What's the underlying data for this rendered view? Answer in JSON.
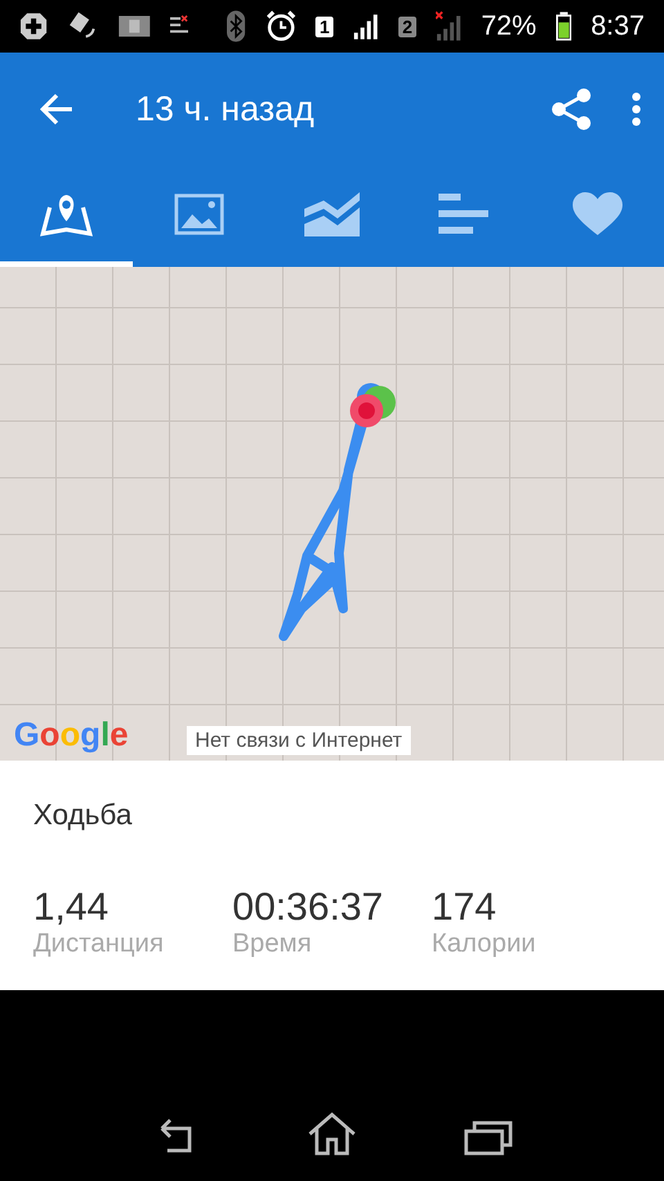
{
  "status_bar": {
    "sim1": "1",
    "sim2": "2",
    "battery": "72%",
    "time": "8:37"
  },
  "app_bar": {
    "title": "13 ч. назад"
  },
  "tabs": [
    {
      "kind": "map",
      "selected": true
    },
    {
      "kind": "photo",
      "selected": false
    },
    {
      "kind": "chart",
      "selected": false
    },
    {
      "kind": "bars",
      "selected": false
    },
    {
      "kind": "heart",
      "selected": false
    }
  ],
  "map": {
    "logo": "Google",
    "toast": "Нет связи с Интернет"
  },
  "activity": {
    "type": "Ходьба",
    "stats": [
      {
        "value": "1,44",
        "label": "Дистанция"
      },
      {
        "value": "00:36:37",
        "label": "Время"
      },
      {
        "value": "174",
        "label": "Калории"
      }
    ]
  }
}
